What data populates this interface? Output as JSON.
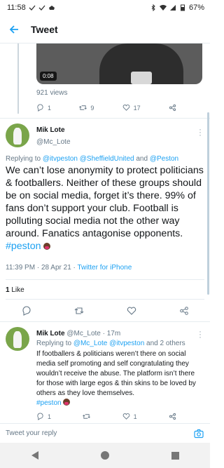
{
  "statusbar": {
    "time": "11:58",
    "battery": "67%"
  },
  "appbar": {
    "title": "Tweet"
  },
  "video": {
    "duration": "0:08",
    "views": "921 views"
  },
  "prev_tweet_actions": {
    "replies": "1",
    "retweets": "9",
    "likes": "17"
  },
  "main_tweet": {
    "name": "Mik Lote",
    "handle": "@Mc_Lote",
    "replying_prefix": "Replying to ",
    "replying_to": [
      "@itvpeston",
      "@SheffieldUnited",
      "@Peston"
    ],
    "replying_and": " and ",
    "text": "We can’t lose anonymity to protect politicians & footballers. Neither of these groups should be on social media, forget it’s there. 99% of fans don’t support your club. Football is polluting social media not the other way around. Fanatics antagonise opponents.",
    "hashtag": "#peston",
    "time": "11:39 PM",
    "date": "28 Apr 21",
    "source": "Twitter for iPhone",
    "likes_count": "1",
    "likes_label": "Like"
  },
  "reply_tweet": {
    "name": "Mik Lote",
    "handle": "@Mc_Lote",
    "age": "17m",
    "replying_prefix": "Replying to ",
    "replying_to": "@Mc_Lote @itvpeston",
    "replying_suffix": " and 2 others",
    "text": "If footballers & politicians weren’t there on social media self promoting and self congratulating they wouldn’t receive the abuse. The platform isn’t there for those with large egos & thin skins to be loved by others as they love themselves.",
    "hashtag": "#peston",
    "replies": "1",
    "likes": "1"
  },
  "compose": {
    "placeholder": "Tweet your reply"
  },
  "colors": {
    "accent": "#1da1f2",
    "muted": "#657786",
    "text": "#14171a"
  }
}
